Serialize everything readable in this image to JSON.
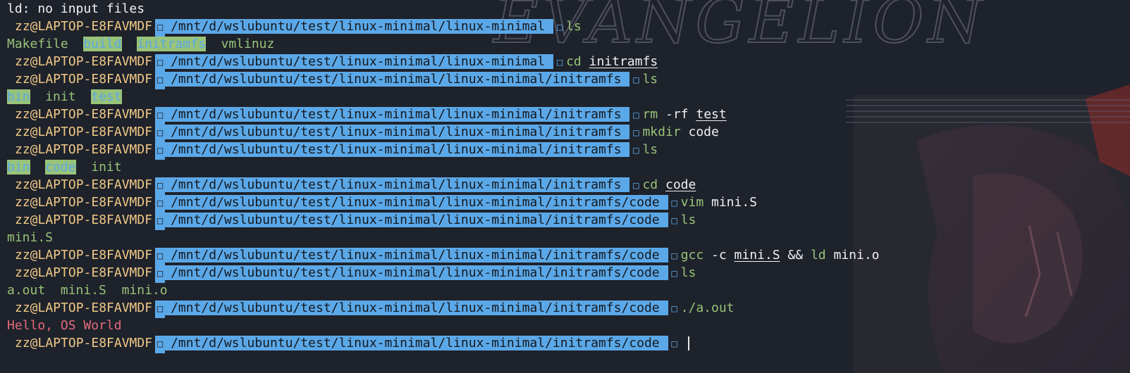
{
  "colors": {
    "background": "#1e222b",
    "host": "#f0c987",
    "path_bg": "#5ba8e8",
    "command": "#98c379",
    "error_out": "#e36a7a"
  },
  "banner_text": "EVANGELION",
  "prompt": {
    "host": "zz@LAPTOP-E8FAVMDF",
    "glyph": "□",
    "paths": {
      "p1": "/mnt/d/wslubuntu/test/linux-minimal/linux-minimal",
      "p2": "/mnt/d/wslubuntu/test/linux-minimal/linux-minimal/initramfs",
      "p3": "/mnt/d/wslubuntu/test/linux-minimal/linux-minimal/initramfs/code"
    }
  },
  "lines": {
    "l0": "ld: no input files",
    "l1_cmd": "ls",
    "l2": [
      "Makefile",
      "build",
      "initramfs",
      "vmlinuz"
    ],
    "l3_cmd": "cd",
    "l3_arg": "initramfs",
    "l4_cmd": "ls",
    "l5": [
      "bin",
      "init",
      "test"
    ],
    "l6_cmd": "rm",
    "l6_flag": "-rf",
    "l6_arg": "test",
    "l7_cmd": "mkdir",
    "l7_arg": "code",
    "l8_cmd": "ls",
    "l9": [
      "bin",
      "code",
      "init"
    ],
    "l10_cmd": "cd",
    "l10_arg": "code",
    "l11_cmd": "vim",
    "l11_arg": "mini.S",
    "l12_cmd": "ls",
    "l13": "mini.S",
    "l14_cmd": "gcc",
    "l14_flag": "-c",
    "l14_arg": "mini.S",
    "l14_op": "&&",
    "l14_cmd2": "ld",
    "l14_arg2": "mini.o",
    "l15_cmd": "ls",
    "l16": [
      "a.out",
      "mini.S",
      "mini.o"
    ],
    "l17_cmd": "./a.out",
    "l18": "Hello, OS World"
  }
}
